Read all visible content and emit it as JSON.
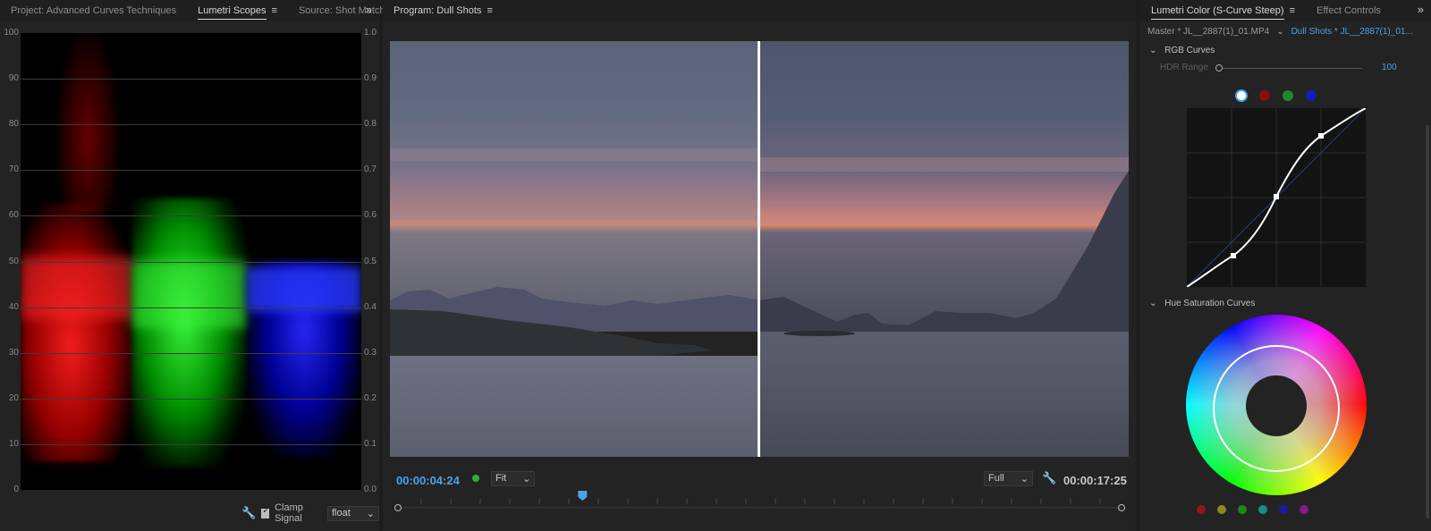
{
  "scopes_panel": {
    "tabs": [
      "Project: Advanced Curves Techniques",
      "Lumetri Scopes",
      "Source: Shot Matching"
    ],
    "active_tab": "Lumetri Scopes",
    "overflow": "»",
    "left_axis": [
      "100",
      "90",
      "80",
      "70",
      "60",
      "50",
      "40",
      "30",
      "20",
      "10",
      "0"
    ],
    "right_axis": [
      "1.0",
      "0.9",
      "0.8",
      "0.7",
      "0.6",
      "0.5",
      "0.4",
      "0.3",
      "0.2",
      "0.1",
      "0.0"
    ],
    "clamp_label": "Clamp Signal",
    "clamp_checked": true,
    "float_value": "float"
  },
  "program_panel": {
    "title": "Program: Dull Shots",
    "timecode_current": "00:00:04:24",
    "timecode_duration": "00:00:17:25",
    "zoom_value": "Fit",
    "resolution_value": "Full",
    "playhead_fraction": 0.255
  },
  "lumetri_panel": {
    "tabs": [
      "Lumetri Color (S-Curve Steep)",
      "Effect Controls"
    ],
    "active_tab": "Lumetri Color (S-Curve Steep)",
    "master_clip": "Master * JL__2887(1)_01.MP4",
    "sequence_clip": "Dull Shots * JL__2887(1)_01...",
    "rgb_curves_label": "RGB Curves",
    "hdr_range_label": "HDR Range",
    "hdr_range_value": "100",
    "channel_colors": [
      "#ffffff",
      "#8b0d0d",
      "#1f8a2a",
      "#1a1ab8"
    ],
    "hue_sat_label": "Hue Saturation Curves",
    "swatch_colors": [
      "#8b1a1a",
      "#8a8a1a",
      "#1a8a1a",
      "#1a8a8a",
      "#1a1aaa",
      "#8a1a8a"
    ]
  },
  "icons": {
    "wrench": "wrench-icon",
    "menu": "panel-menu-icon",
    "chevron": "chevron-down-icon"
  }
}
